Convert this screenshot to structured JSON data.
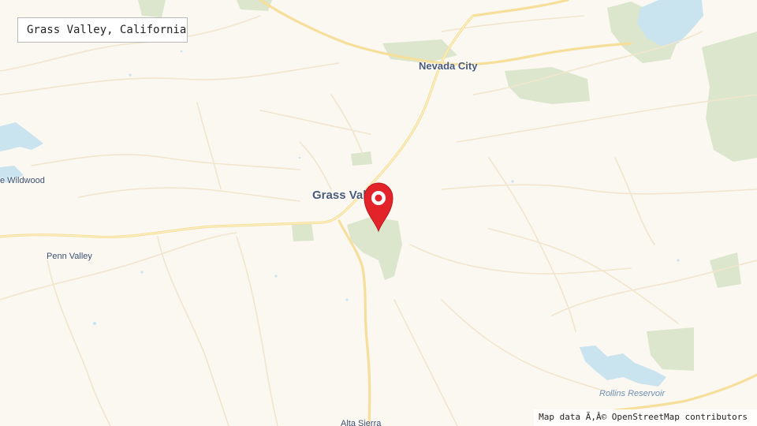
{
  "map": {
    "title": "Grass Valley, California",
    "attribution": "Map data Ã‚Â© OpenStreetMap contributors",
    "colors": {
      "land": "#fbf8f2",
      "park": "#dbe6cc",
      "water": "#c9e3ef",
      "major_road": "#f6df9a",
      "minor_road": "#f1e6cd",
      "marker": "#e2232a"
    },
    "places": {
      "nevada_city": "Nevada City",
      "grass_valley": "Grass Valley",
      "lake_wildwood": "e Wildwood",
      "penn_valley": "Penn Valley",
      "alta_sierra": "Alta Sierra"
    },
    "water": {
      "rollins": "Rollins Reservoir"
    },
    "marker_icon": "map-pin-icon"
  }
}
